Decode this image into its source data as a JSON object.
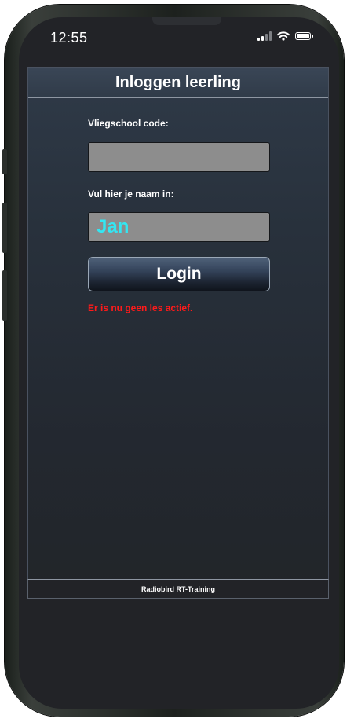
{
  "status_bar": {
    "time": "12:55",
    "icons": [
      "cellular-signal-icon",
      "wifi-icon",
      "battery-icon"
    ]
  },
  "header": {
    "title": "Inloggen leerling"
  },
  "form": {
    "school_code": {
      "label": "Vliegschool code:",
      "value": ""
    },
    "name": {
      "label": "Vul hier je naam in:",
      "value": "Jan"
    },
    "login_label": "Login",
    "error_message": "Er is nu geen les actief."
  },
  "footer": {
    "text": "Radiobird RT-Training"
  },
  "colors": {
    "error": "#ff1a1a",
    "name_text": "#33e6f2",
    "input_bg": "#8d8d8d"
  }
}
